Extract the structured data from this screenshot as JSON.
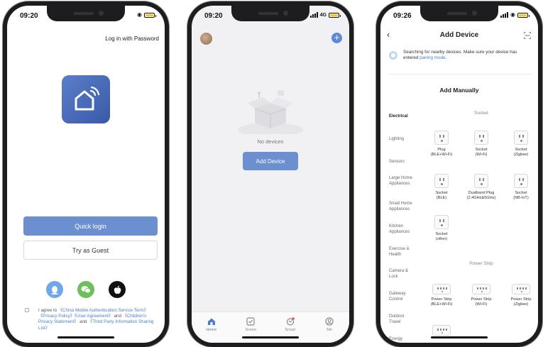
{
  "screen1": {
    "time": "09:20",
    "password_link": "Log in with Password",
    "quick_login": "Quick login",
    "guest": "Try as Guest",
    "agree_prefix": "I agree to ",
    "link1": "《China Mobile Authentication Service Term》",
    "link2": "《Privacy Policy》",
    "link3": "《User Agreement》",
    "and1": " and ",
    "link4": "《Children's Privacy Statement》",
    "and2": " and ",
    "link5": "《Third Party Information Sharing List》",
    "social_icons": [
      "qq-icon",
      "wechat-icon",
      "apple-icon"
    ]
  },
  "screen2": {
    "time": "09:20",
    "network": "4G",
    "empty_text": "No devices",
    "add_button": "Add Device",
    "tabs": [
      {
        "label": "Home",
        "icon": "home-icon",
        "active": true
      },
      {
        "label": "Scene",
        "icon": "scene-icon",
        "active": false
      },
      {
        "label": "Smart",
        "icon": "smart-icon",
        "active": false
      },
      {
        "label": "Me",
        "icon": "me-icon",
        "active": false
      }
    ]
  },
  "screen3": {
    "time": "09:26",
    "title": "Add Device",
    "search_text": "Searching for nearby devices. Make sure your device has entered ",
    "search_link": "pairing mode",
    "search_end": ".",
    "manual_title": "Add Manually",
    "categories": [
      "Electrical",
      "Lighting",
      "Sensors",
      "Large Home Appliances",
      "Small Home Appliances",
      "Kitchen Appliances",
      "Exercise & Health",
      "Camera & Lock",
      "Gateway Control",
      "Outdoor Travel",
      "Energy"
    ],
    "socket_section": "Socket",
    "sockets": [
      {
        "line1": "Plug",
        "line2": "(BLE+Wi-Fi)"
      },
      {
        "line1": "Socket",
        "line2": "(Wi-Fi)"
      },
      {
        "line1": "Socket",
        "line2": "(Zigbee)"
      },
      {
        "line1": "Socket",
        "line2": "(BLE)"
      },
      {
        "line1": "Dualband Plug",
        "line2": "(2.4GHz&5GHz)"
      },
      {
        "line1": "Socket",
        "line2": "(NB-IoT)"
      },
      {
        "line1": "Socket",
        "line2": "(other)"
      }
    ],
    "strip_section": "Power Strip",
    "strips": [
      {
        "line1": "Power Strip",
        "line2": "(BLE+Wi-Fi)"
      },
      {
        "line1": "Power Strip",
        "line2": "(Wi-Fi)"
      },
      {
        "line1": "Power Strip",
        "line2": "(Zigbee)"
      }
    ]
  }
}
